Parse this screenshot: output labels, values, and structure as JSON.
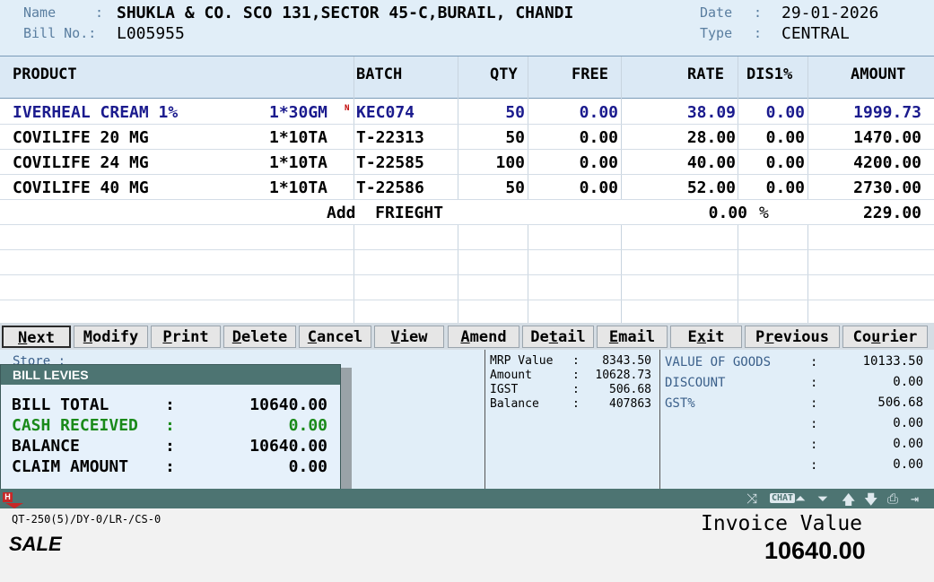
{
  "header": {
    "name_label": "Name",
    "name_value": "SHUKLA & CO. SCO 131,SECTOR 45-C,BURAIL, CHANDI",
    "bill_label": "Bill No.:",
    "bill_value": "L005955",
    "date_label": "Date",
    "date_value": "29-01-2026",
    "type_label": "Type",
    "type_value": "CENTRAL",
    "sep": ":"
  },
  "table": {
    "columns": [
      "PRODUCT",
      "BATCH",
      "QTY",
      "FREE",
      "RATE",
      "DIS1%",
      "AMOUNT"
    ],
    "rows": [
      {
        "product": "IVERHEAL CREAM 1%",
        "pack": "1*30GM",
        "flag": "N",
        "batch": "KEC074",
        "qty": "50",
        "free": "0.00",
        "rate": "38.09",
        "dis": "0.00",
        "amount": "1999.73"
      },
      {
        "product": "COVILIFE 20 MG",
        "pack": "1*10TA",
        "flag": "",
        "batch": "T-22313",
        "qty": "50",
        "free": "0.00",
        "rate": "28.00",
        "dis": "0.00",
        "amount": "1470.00"
      },
      {
        "product": "COVILIFE 24 MG",
        "pack": "1*10TA",
        "flag": "",
        "batch": "T-22585",
        "qty": "100",
        "free": "0.00",
        "rate": "40.00",
        "dis": "0.00",
        "amount": "4200.00"
      },
      {
        "product": "COVILIFE 40 MG",
        "pack": "1*10TA",
        "flag": "",
        "batch": "T-22586",
        "qty": "50",
        "free": "0.00",
        "rate": "52.00",
        "dis": "0.00",
        "amount": "2730.00"
      }
    ],
    "freight": {
      "label": "Add  FRIEGHT",
      "percent": "0.00",
      "pct_sign": "%",
      "amount": "229.00"
    }
  },
  "buttons": [
    {
      "pre": "",
      "u": "N",
      "post": "ext",
      "active": true
    },
    {
      "pre": "",
      "u": "M",
      "post": "odify",
      "active": false
    },
    {
      "pre": "",
      "u": "P",
      "post": "rint",
      "active": false
    },
    {
      "pre": "",
      "u": "D",
      "post": "elete",
      "active": false
    },
    {
      "pre": "",
      "u": "C",
      "post": "ancel",
      "active": false
    },
    {
      "pre": "",
      "u": "V",
      "post": "iew",
      "active": false
    },
    {
      "pre": "",
      "u": "A",
      "post": "mend",
      "active": false
    },
    {
      "pre": "De",
      "u": "t",
      "post": "ail",
      "active": false
    },
    {
      "pre": "",
      "u": "E",
      "post": "mail",
      "active": false
    },
    {
      "pre": "E",
      "u": "x",
      "post": "it",
      "active": false
    },
    {
      "pre": "P",
      "u": "r",
      "post": "evious",
      "active": false
    },
    {
      "pre": "Co",
      "u": "u",
      "post": "rier",
      "active": false
    }
  ],
  "store_label": "Store :",
  "summary": {
    "mrp_label": "MRP Value",
    "mrp_value": "8343.50",
    "amount_label": "Amount",
    "amount_value": "10628.73",
    "igst_label": "IGST",
    "igst_value": "506.68",
    "balance_label": "Balance",
    "balance_value": "407863"
  },
  "totals": [
    {
      "label": "VALUE OF GOODS",
      "value": "10133.50"
    },
    {
      "label": "DISCOUNT",
      "value": "0.00"
    },
    {
      "label": "GST%",
      "value": "506.68"
    },
    {
      "label": "",
      "value": "0.00"
    },
    {
      "label": "",
      "value": "0.00"
    },
    {
      "label": "",
      "value": "0.00"
    }
  ],
  "levies": {
    "title": "BILL LEVIES",
    "bill_total_label": "BILL TOTAL",
    "bill_total_value": "10640.00",
    "cash_label": "CASH RECEIVED",
    "cash_value": "0.00",
    "balance_label": "BALANCE",
    "balance_value": "10640.00",
    "claim_label": "CLAIM AMOUNT",
    "claim_value": "0.00"
  },
  "footer": {
    "info": "QT-250(5)/DY-0/LR-/CS-0",
    "mode": "SALE",
    "invoice_label": "Invoice Value",
    "invoice_value": "10640.00"
  },
  "colors": {
    "header_bg": "#e1eef8",
    "status_bg": "#4d7472",
    "row_blue": "#1b1b8e",
    "cash_green": "#1a8a1a"
  }
}
